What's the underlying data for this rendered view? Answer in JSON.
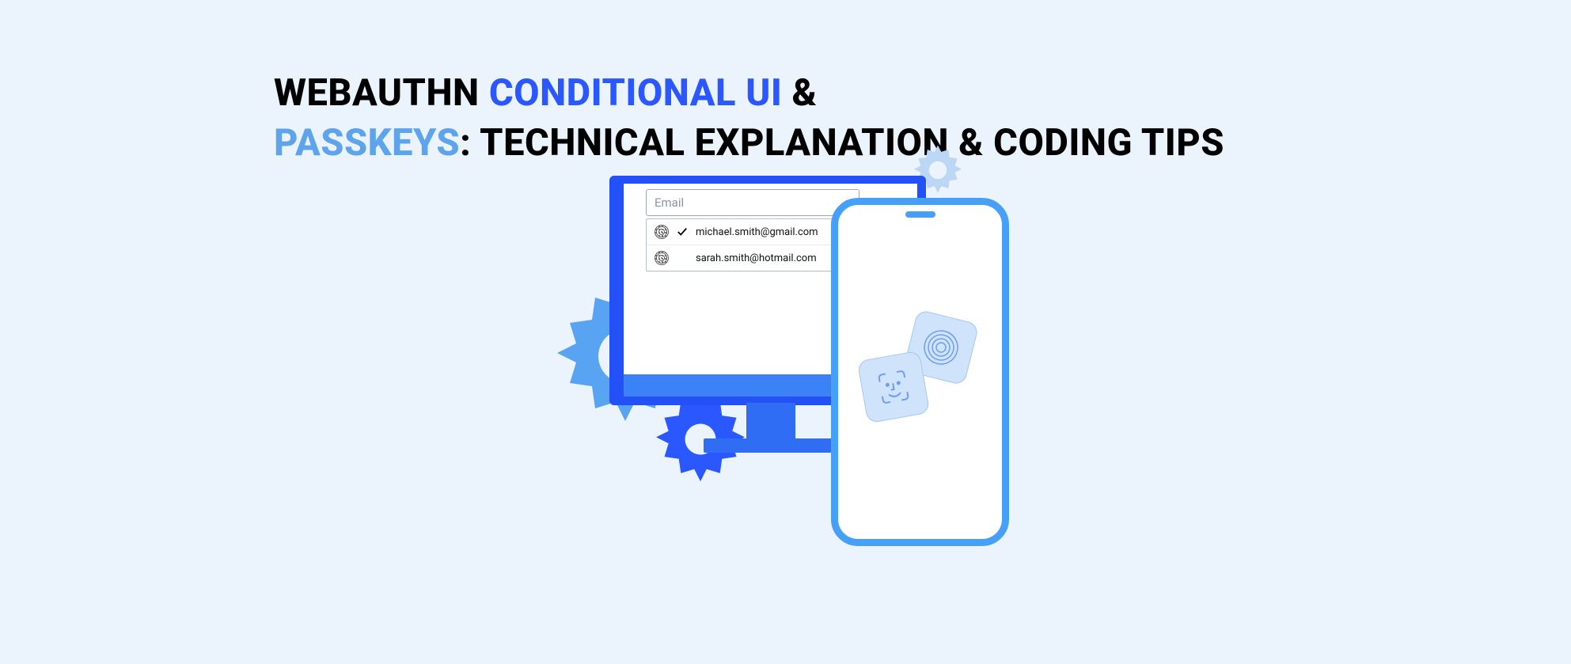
{
  "headline": {
    "part1": "WEBAUTHN ",
    "part2": "CONDITIONAL UI",
    "part3": " & ",
    "part4": "PASSKEYS",
    "part5": ": TECHNICAL EXPLANATION & CODING TIPS"
  },
  "email_field": {
    "label": "Email"
  },
  "email_options": [
    {
      "address": "michael.smith@gmail.com",
      "selected": true
    },
    {
      "address": "sarah.smith@hotmail.com",
      "selected": false
    }
  ]
}
